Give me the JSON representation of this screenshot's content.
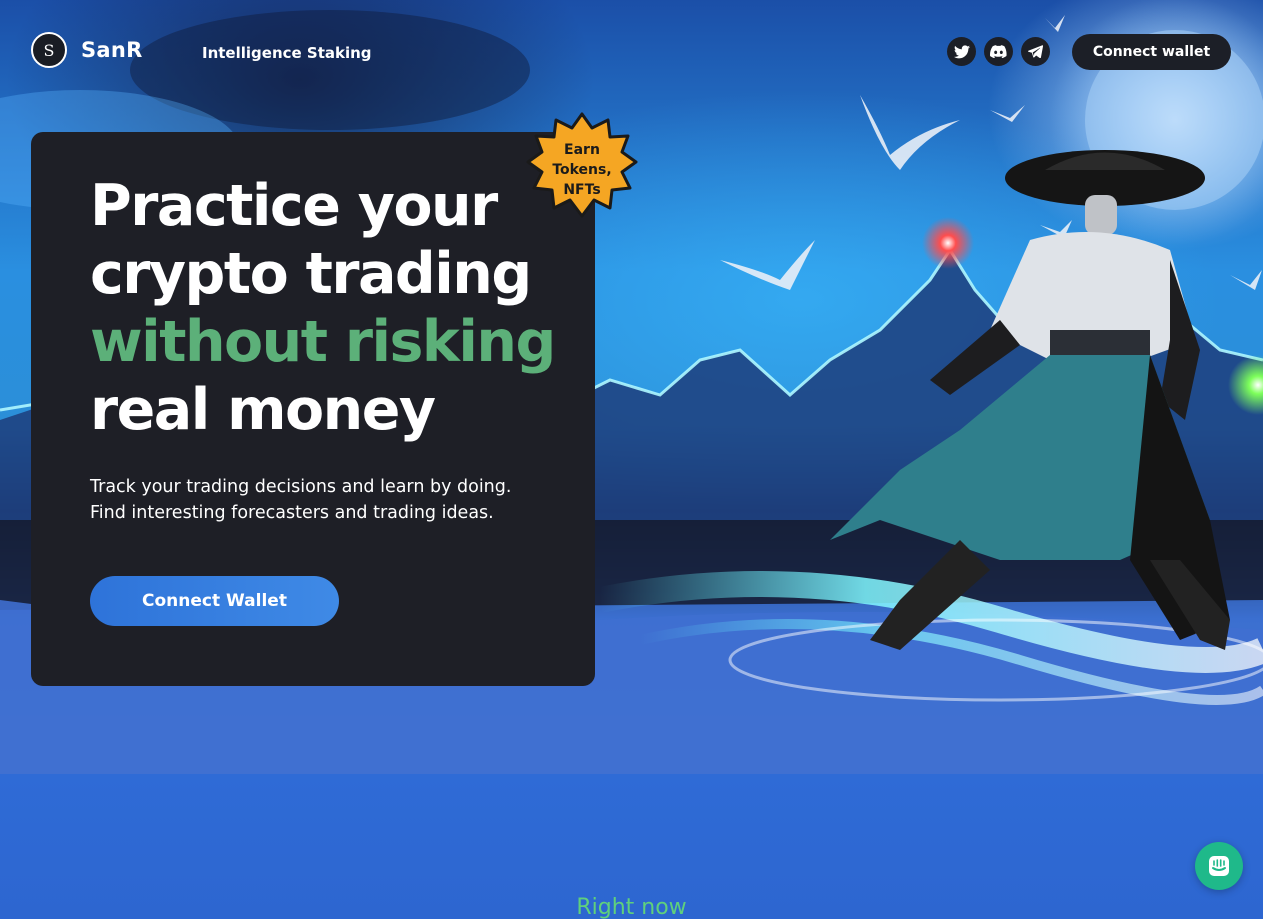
{
  "header": {
    "logo_mark": "S",
    "brand": "SanR",
    "nav_link": "Intelligence Staking",
    "connect_button": "Connect wallet",
    "socials": [
      {
        "icon": "twitter-icon"
      },
      {
        "icon": "discord-icon"
      },
      {
        "icon": "telegram-icon"
      }
    ]
  },
  "hero": {
    "headline_line1": "Practice your",
    "headline_line2": "crypto trading",
    "headline_accent": "without risking",
    "headline_line4": "real money",
    "subtitle_line1": "Track your trading decisions and learn by doing.",
    "subtitle_line2": "Find interesting forecasters and trading ideas.",
    "cta_button": "Connect Wallet",
    "badge_line1": "Earn",
    "badge_line2": "Tokens,",
    "badge_line3": "NFTs"
  },
  "section": {
    "heading": "Right now"
  },
  "chat": {
    "icon": "chat-icon"
  },
  "colors": {
    "card_bg": "#1e1f26",
    "accent_green": "#5cb079",
    "badge_orange": "#f5a623",
    "cta_blue": "#2e73d9",
    "chat_green": "#1fb98a"
  }
}
